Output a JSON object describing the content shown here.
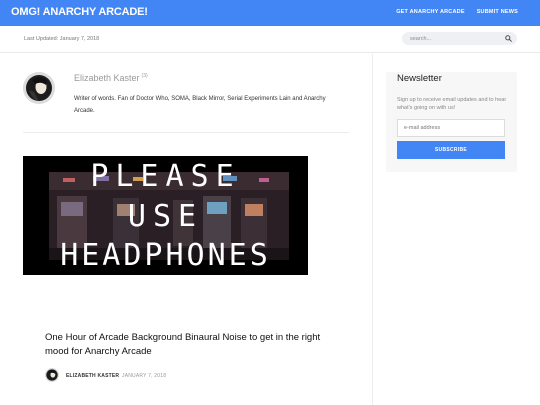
{
  "header": {
    "brand": "OMG! ANARCHY ARCADE!",
    "nav": [
      "GET ANARCHY ARCADE",
      "SUBMIT NEWS"
    ],
    "accent_color": "#4285f4"
  },
  "subbar": {
    "last_updated": "Last Updated: January 7, 2018",
    "search_placeholder": "search...",
    "search_icon": "search-icon"
  },
  "author": {
    "name": "Elizabeth Kaster",
    "count": "(3)",
    "bio": "Writer of words. Fan of Doctor Who, SOMA, Black Mirror, Serial Experiments Lain and Anarchy Arcade."
  },
  "post": {
    "image_text": [
      "PLEASE",
      "USE",
      "HEADPHONES"
    ],
    "title": "One Hour of Arcade Background Binaural Noise to get in the right mood for Anarchy Arcade",
    "author": "ELIZABETH KASTER",
    "date": "JANUARY 7, 2018"
  },
  "newsletter": {
    "title": "Newsletter",
    "text": "Sign up to receive email updates and to hear what's going on with us!",
    "email_placeholder": "e-mail address",
    "button": "SUBSCRIBE"
  }
}
